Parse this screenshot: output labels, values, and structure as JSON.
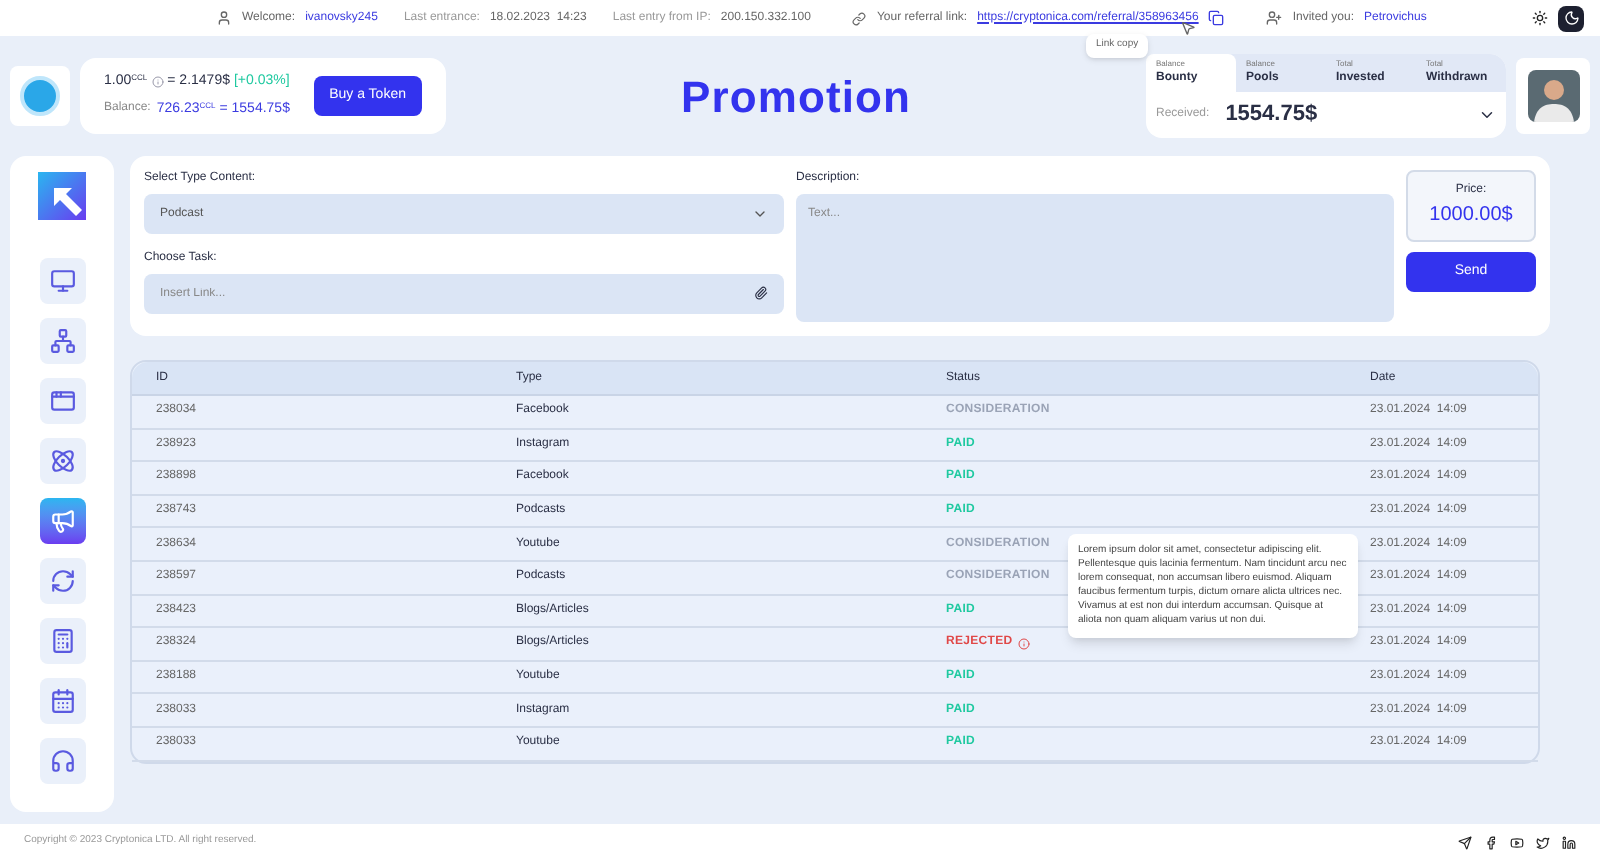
{
  "topbar": {
    "welcome_label": "Welcome:",
    "username": "ivanovsky245",
    "last_entrance_label": "Last entrance:",
    "last_entrance": "18.02.2023  14:23",
    "ip_label": "Last entry from IP:",
    "ip": "200.150.332.100",
    "referral_label": "Your referral link:",
    "referral_link": "https://cryptonica.com/referral/358963456",
    "copy_tooltip": "Link copy",
    "invited_label": "Invited you:",
    "invited_by": "Petrovichus",
    "theme": [
      {
        "kind": "sun",
        "selected": false
      },
      {
        "kind": "moon",
        "selected": true
      }
    ]
  },
  "token": {
    "rate": "1.00$^{CCL}$",
    "rate_value": "= 2.1479$",
    "change": "[+0.03%]",
    "balance_label": "Balance:",
    "balance": "726.23$^{CCL}$ = 1554.75$",
    "buy_button": "Buy a Token"
  },
  "page_title": "Promotion",
  "wallet": {
    "tabs": [
      {
        "small": "Balance",
        "label": "Bounty",
        "selected": true
      },
      {
        "small": "Balance",
        "label": "Pools",
        "selected": false
      },
      {
        "small": "Total",
        "label": "Invested",
        "selected": false
      },
      {
        "small": "Total",
        "label": "Withdrawn",
        "selected": false
      }
    ],
    "received_label": "Received:",
    "received": "1554.75$"
  },
  "sidebar": {
    "items": [
      {
        "kind": "monitor",
        "selected": false
      },
      {
        "kind": "network",
        "selected": false
      },
      {
        "kind": "window",
        "selected": false
      },
      {
        "kind": "atom",
        "selected": false
      },
      {
        "kind": "megaphone",
        "selected": true
      },
      {
        "kind": "exchange",
        "selected": false
      },
      {
        "kind": "calculator",
        "selected": false
      },
      {
        "kind": "calendar",
        "selected": false
      },
      {
        "kind": "support",
        "selected": false
      }
    ]
  },
  "form": {
    "type_label": "Select Type Content:",
    "type_value": "Podcast",
    "task_label": "Choose Task:",
    "task_placeholder": "Insert Link...",
    "description_label": "Description:",
    "description_placeholder": "Text...",
    "price_label": "Price:",
    "price": "1000.00$",
    "send_button": "Send"
  },
  "table": {
    "columns": [
      "ID",
      "Type",
      "Status",
      "Date"
    ],
    "rows": [
      {
        "id": "238034",
        "type": "Facebook",
        "status": "CONSIDERATION",
        "kind": "consideration",
        "date": "23.01.2024  14:09"
      },
      {
        "id": "238923",
        "type": "Instagram",
        "status": "PAID",
        "kind": "paid",
        "date": "23.01.2024  14:09"
      },
      {
        "id": "238898",
        "type": "Facebook",
        "status": "PAID",
        "kind": "paid",
        "date": "23.01.2024  14:09"
      },
      {
        "id": "238743",
        "type": "Podcasts",
        "status": "PAID",
        "kind": "paid",
        "date": "23.01.2024  14:09"
      },
      {
        "id": "238634",
        "type": "Youtube",
        "status": "CONSIDERATION",
        "kind": "consideration",
        "date": "23.01.2024  14:09"
      },
      {
        "id": "238597",
        "type": "Podcasts",
        "status": "CONSIDERATION",
        "kind": "consideration",
        "date": "23.01.2024  14:09"
      },
      {
        "id": "238423",
        "type": "Blogs/Articles",
        "status": "PAID",
        "kind": "paid",
        "date": "23.01.2024  14:09"
      },
      {
        "id": "238324",
        "type": "Blogs/Articles",
        "status": "REJECTED",
        "kind": "rejected",
        "date": "23.01.2024  14:09"
      },
      {
        "id": "238188",
        "type": "Youtube",
        "status": "PAID",
        "kind": "paid",
        "date": "23.01.2024  14:09"
      },
      {
        "id": "238033",
        "type": "Instagram",
        "status": "PAID",
        "kind": "paid",
        "date": "23.01.2024  14:09"
      },
      {
        "id": "238033",
        "type": "Youtube",
        "status": "PAID",
        "kind": "paid",
        "date": "23.01.2024  14:09"
      }
    ],
    "tooltip": "Lorem ipsum dolor sit amet, consectetur adipiscing elit. Pellentesque quis lacinia fermentum. Nam tincidunt arcu nec lorem consequat, non accumsan libero euismod. Aliquam faucibus fermentum turpis, dictum ornare alicta ultrices nec. Vivamus at est non dui interdum accumsan. Quisque at aliota non quam aliquam varius ut non dui."
  },
  "footer": {
    "copyright": "Copyright © 2023 Cryptonica LTD. All right reserved.",
    "social": [
      {
        "kind": "telegram"
      },
      {
        "kind": "facebook"
      },
      {
        "kind": "youtube"
      },
      {
        "kind": "twitter"
      },
      {
        "kind": "linkedin"
      }
    ]
  }
}
